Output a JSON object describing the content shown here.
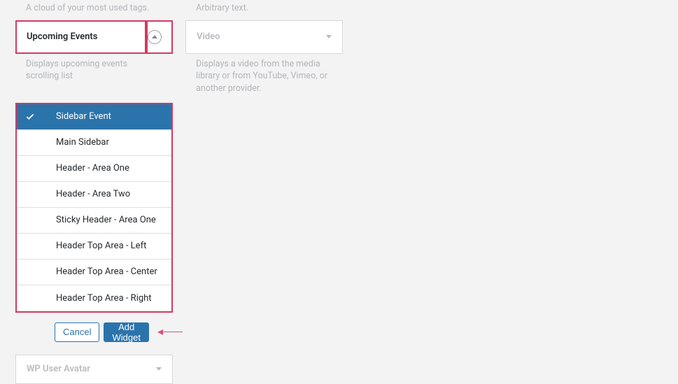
{
  "left_col": {
    "top_desc": "A cloud of your most used tags.",
    "widget_title": "Upcoming Events",
    "widget_desc": "Displays upcoming events scrolling list",
    "sidebar_options": [
      {
        "label": "Sidebar Event",
        "selected": true
      },
      {
        "label": "Main Sidebar",
        "selected": false
      },
      {
        "label": "Header - Area One",
        "selected": false
      },
      {
        "label": "Header - Area Two",
        "selected": false
      },
      {
        "label": "Sticky Header - Area One",
        "selected": false
      },
      {
        "label": "Header Top Area - Left",
        "selected": false
      },
      {
        "label": "Header Top Area - Center",
        "selected": false
      },
      {
        "label": "Header Top Area - Right",
        "selected": false
      }
    ],
    "buttons": {
      "cancel": "Cancel",
      "add": "Add Widget"
    },
    "avatar_widget": "WP User Avatar"
  },
  "right_col": {
    "top_desc": "Arbitrary text.",
    "widget_title": "Video",
    "widget_desc": "Displays a video from the media library or from YouTube, Vimeo, or another provider."
  }
}
